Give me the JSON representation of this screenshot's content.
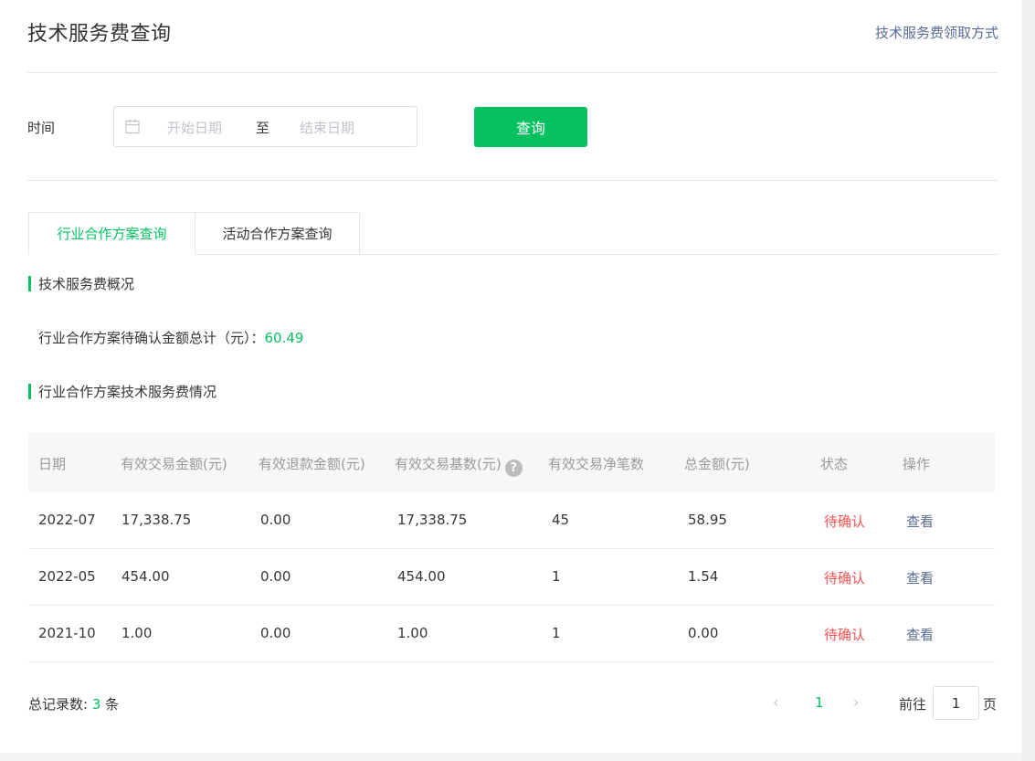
{
  "header": {
    "title": "技术服务费查询",
    "link": "技术服务费领取方式"
  },
  "filter": {
    "label": "时间",
    "start_placeholder": "开始日期",
    "separator": "至",
    "end_placeholder": "结束日期",
    "query_button": "查询"
  },
  "tabs": [
    {
      "label": "行业合作方案查询",
      "active": true
    },
    {
      "label": "活动合作方案查询",
      "active": false
    }
  ],
  "overview": {
    "title": "技术服务费概况",
    "summary_label": "行业合作方案待确认金额总计（元）：",
    "summary_value": "60.49"
  },
  "details": {
    "title": "行业合作方案技术服务费情况"
  },
  "table": {
    "columns": [
      "日期",
      "有效交易金额(元)",
      "有效退款金额(元)",
      "有效交易基数(元)",
      "有效交易净笔数",
      "总金额(元)",
      "状态",
      "操作"
    ],
    "rows": [
      [
        "2022-07",
        "17,338.75",
        "0.00",
        "17,338.75",
        "45",
        "58.95",
        "待确认",
        "查看"
      ],
      [
        "2022-05",
        "454.00",
        "0.00",
        "454.00",
        "1",
        "1.54",
        "待确认",
        "查看"
      ],
      [
        "2021-10",
        "1.00",
        "0.00",
        "1.00",
        "1",
        "0.00",
        "待确认",
        "查看"
      ]
    ]
  },
  "footer": {
    "total_label": "总记录数:",
    "total_count": "3",
    "total_unit": "条",
    "current_page": "1",
    "goto_label": "前往",
    "goto_value": "1",
    "goto_suffix": "页"
  },
  "colors": {
    "accent": "#07c160",
    "link": "#576b95",
    "status_pending": "#fa5151"
  }
}
